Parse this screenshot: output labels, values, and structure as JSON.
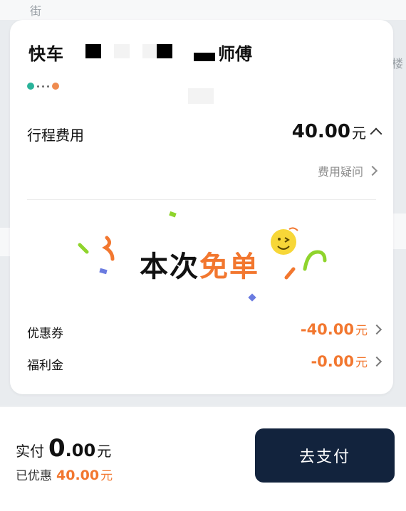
{
  "map": {
    "street_label": "街",
    "building_label": "楼"
  },
  "trip": {
    "car_type": "快车",
    "driver_suffix": "师傅"
  },
  "fees": {
    "trip_fee_label": "行程费用",
    "trip_fee_value": "40.00",
    "currency_unit": "元",
    "fee_question_label": "费用疑问"
  },
  "promo": {
    "text_part1": "本次",
    "text_part2": "免单"
  },
  "discounts": [
    {
      "label": "优惠券",
      "value": "-40.00",
      "unit": "元"
    },
    {
      "label": "福利金",
      "value": "-0.00",
      "unit": "元"
    }
  ],
  "payment": {
    "paid_label": "实付",
    "paid_value_int": "0",
    "paid_value_dec": ".00",
    "paid_unit": "元",
    "discounted_label": "已优惠",
    "discounted_value": "40.00",
    "discounted_unit": "元",
    "pay_button_label": "去支付"
  },
  "colors": {
    "accent_orange": "#f2772f",
    "pay_button_bg": "#12233d",
    "start_dot": "#2ab39a",
    "end_dot": "#ef8b4f"
  }
}
